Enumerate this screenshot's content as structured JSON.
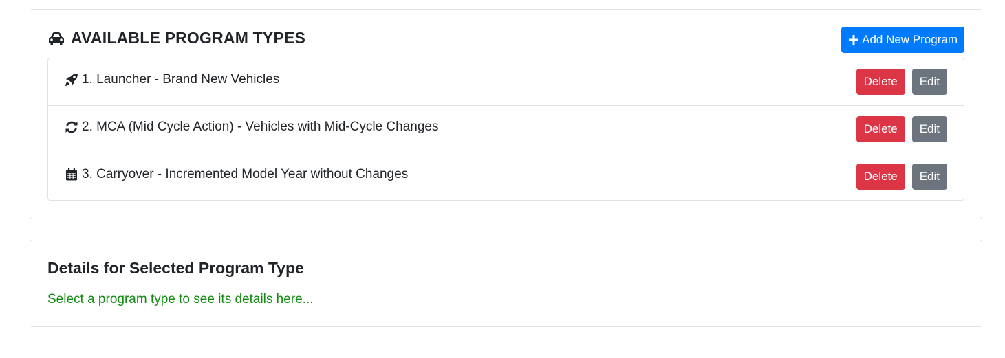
{
  "programs_card": {
    "title": "AVAILABLE PROGRAM TYPES",
    "title_icon": "car-icon",
    "add_button_label": "Add New Program",
    "add_button_icon": "plus-icon"
  },
  "programs": [
    {
      "label": "1. Launcher - Brand New Vehicles",
      "icon": "rocket-icon",
      "delete_label": "Delete",
      "edit_label": "Edit"
    },
    {
      "label": "2. MCA (Mid Cycle Action) - Vehicles with Mid-Cycle Changes",
      "icon": "sync-icon",
      "delete_label": "Delete",
      "edit_label": "Edit"
    },
    {
      "label": "3. Carryover - Incremented Model Year without Changes",
      "icon": "calendar-icon",
      "delete_label": "Delete",
      "edit_label": "Edit"
    }
  ],
  "details_card": {
    "title": "Details for Selected Program Type",
    "placeholder_text": "Select a program type to see its details here..."
  },
  "colors": {
    "primary": "#007bff",
    "danger": "#dc3545",
    "secondary": "#6c757d",
    "success_text": "#138a13",
    "border": "#dee2e6"
  }
}
